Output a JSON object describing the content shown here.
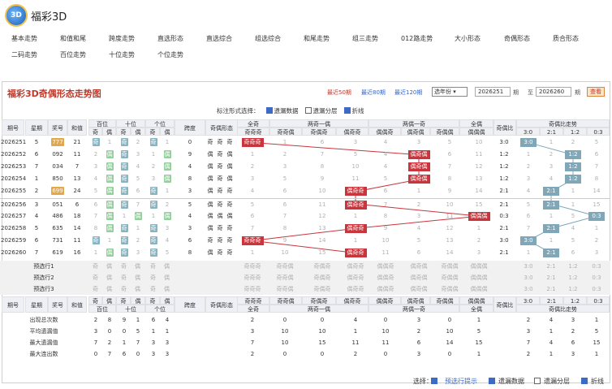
{
  "app": {
    "title": "福彩3D",
    "logo_text": "3D"
  },
  "nav": [
    [
      "基本走势",
      "和值和尾",
      "跨度走势",
      "直选形态",
      "直选综合",
      "组选综合",
      "和尾走势",
      "组三走势",
      "012路走势",
      "大小形态",
      "奇偶形态",
      "质合形态"
    ],
    [
      "二码走势",
      "百位走势",
      "十位走势",
      "个位走势"
    ]
  ],
  "panel": {
    "title": "福彩3D奇偶形态走势图",
    "ranges": [
      "最近50期",
      "最近80期",
      "最近120期"
    ],
    "year_select": "选年份",
    "from": "2026251",
    "from_unit": "期",
    "to_label": "至",
    "to": "2026260",
    "to_unit": "期",
    "query_label": "查看",
    "options_label": "标注形式选择：",
    "options": [
      "遗漏数据",
      "遗漏分层",
      "折线"
    ]
  },
  "headers": {
    "top": [
      "期号",
      "星期",
      "奖号",
      "和值",
      "百位",
      "十位",
      "个位",
      "跨度",
      "奇偶形态",
      "全奇",
      "两奇一偶",
      "两偶一奇",
      "全偶",
      "奇偶比",
      "奇偶比走势"
    ],
    "sub": [
      "奇",
      "偶",
      "奇",
      "偶",
      "奇",
      "偶",
      "奇奇奇",
      "奇奇偶",
      "奇偶奇",
      "偶奇奇",
      "偶偶奇",
      "偶奇偶",
      "奇偶偶",
      "偶偶偶",
      "3:0",
      "2:1",
      "1:2",
      "0:3"
    ]
  },
  "rows": [
    {
      "issue": "2026251",
      "week": "5",
      "num": "777",
      "sum": "21",
      "bai": [
        "奇",
        "1"
      ],
      "shi": [
        "奇",
        "2"
      ],
      "ge": [
        "奇",
        "1"
      ],
      "span": "0",
      "form": [
        "奇",
        "奇",
        "奇"
      ],
      "cols": [
        "奇奇奇",
        "1",
        "6",
        "3",
        "4",
        "3",
        "5",
        "10"
      ],
      "ratio": "3:0",
      "rt": [
        "3:0",
        "1",
        "2",
        "5"
      ]
    },
    {
      "issue": "2026252",
      "week": "6",
      "num": "092",
      "sum": "11",
      "bai": [
        "2",
        "偶"
      ],
      "shi": [
        "奇",
        "3"
      ],
      "ge": [
        "1",
        "偶"
      ],
      "span": "9",
      "form": [
        "偶",
        "奇",
        "偶"
      ],
      "cols": [
        "1",
        "2",
        "7",
        "5",
        "4",
        "偶奇偶",
        "6",
        "11"
      ],
      "ratio": "1:2",
      "rt": [
        "1",
        "2",
        "1:2",
        "6"
      ]
    },
    {
      "issue": "2026253",
      "week": "7",
      "num": "034",
      "sum": "7",
      "bai": [
        "3",
        "偶"
      ],
      "shi": [
        "奇",
        "4"
      ],
      "ge": [
        "2",
        "偶"
      ],
      "span": "4",
      "form": [
        "偶",
        "奇",
        "偶"
      ],
      "cols": [
        "2",
        "3",
        "8",
        "10",
        "4",
        "偶奇偶",
        "7",
        "12"
      ],
      "ratio": "1:2",
      "rt": [
        "2",
        "3",
        "1:2",
        "7"
      ]
    },
    {
      "issue": "2026254",
      "week": "1",
      "num": "850",
      "sum": "13",
      "bai": [
        "4",
        "偶"
      ],
      "shi": [
        "奇",
        "5"
      ],
      "ge": [
        "3",
        "偶"
      ],
      "span": "8",
      "form": [
        "偶",
        "奇",
        "偶"
      ],
      "cols": [
        "3",
        "5",
        "9",
        "11",
        "5",
        "偶奇偶",
        "8",
        "13"
      ],
      "ratio": "1:2",
      "rt": [
        "3",
        "4",
        "1:2",
        "8"
      ]
    },
    {
      "issue": "2026255",
      "week": "2",
      "num": "699",
      "sum": "24",
      "bai": [
        "5",
        "偶"
      ],
      "shi": [
        "奇",
        "6"
      ],
      "ge": [
        "奇",
        "1"
      ],
      "span": "3",
      "form": [
        "偶",
        "奇",
        "奇"
      ],
      "cols": [
        "4",
        "6",
        "10",
        "偶奇奇",
        "6",
        "1",
        "9",
        "14"
      ],
      "ratio": "2:1",
      "rt": [
        "4",
        "2:1",
        "1",
        "14"
      ]
    },
    {
      "issue": "2026256",
      "week": "3",
      "num": "051",
      "sum": "6",
      "bai": [
        "6",
        "偶"
      ],
      "shi": [
        "奇",
        "7"
      ],
      "ge": [
        "奇",
        "2"
      ],
      "span": "5",
      "form": [
        "偶",
        "奇",
        "奇"
      ],
      "cols": [
        "5",
        "6",
        "11",
        "偶奇奇",
        "7",
        "2",
        "10",
        "15"
      ],
      "ratio": "2:1",
      "rt": [
        "5",
        "2:1",
        "1",
        "15"
      ]
    },
    {
      "issue": "2026257",
      "week": "4",
      "num": "486",
      "sum": "18",
      "bai": [
        "7",
        "偶"
      ],
      "shi": [
        "1",
        "偶"
      ],
      "ge": [
        "1",
        "偶"
      ],
      "span": "4",
      "form": [
        "偶",
        "偶",
        "偶"
      ],
      "cols": [
        "6",
        "7",
        "12",
        "1",
        "8",
        "3",
        "11",
        "偶偶偶"
      ],
      "ratio": "0:3",
      "rt": [
        "6",
        "1",
        "5",
        "0:3"
      ]
    },
    {
      "issue": "2026258",
      "week": "5",
      "num": "635",
      "sum": "14",
      "bai": [
        "8",
        "偶"
      ],
      "shi": [
        "奇",
        "1"
      ],
      "ge": [
        "奇",
        "3"
      ],
      "span": "3",
      "form": [
        "偶",
        "奇",
        "奇"
      ],
      "cols": [
        "7",
        "8",
        "13",
        "偶奇奇",
        "9",
        "4",
        "12",
        "1"
      ],
      "ratio": "2:1",
      "rt": [
        "7",
        "2:1",
        "4",
        "1"
      ]
    },
    {
      "issue": "2026259",
      "week": "6",
      "num": "731",
      "sum": "11",
      "bai": [
        "奇",
        "1"
      ],
      "shi": [
        "奇",
        "2"
      ],
      "ge": [
        "奇",
        "4"
      ],
      "span": "6",
      "form": [
        "奇",
        "奇",
        "奇"
      ],
      "cols": [
        "奇奇奇",
        "9",
        "14",
        "1",
        "10",
        "5",
        "13",
        "2"
      ],
      "ratio": "3:0",
      "rt": [
        "3:0",
        "1",
        "5",
        "2"
      ]
    },
    {
      "issue": "2026260",
      "week": "7",
      "num": "619",
      "sub": "",
      "sum": "16",
      "bai": [
        "1",
        "偶"
      ],
      "shi": [
        "奇",
        "3"
      ],
      "ge": [
        "奇",
        "5"
      ],
      "span": "8",
      "form": [
        "偶",
        "奇",
        "奇"
      ],
      "cols": [
        "1",
        "10",
        "15",
        "偶奇奇",
        "11",
        "6",
        "14",
        "3"
      ],
      "ratio": "2:1",
      "rt": [
        "1",
        "2:1",
        "6",
        "3"
      ]
    }
  ],
  "forecast": [
    {
      "label": "预选行1",
      "cols": [
        "奇偶",
        "奇偶",
        "奇偶",
        "奇奇奇",
        "奇奇偶",
        "奇偶奇",
        "偶奇奇",
        "偶偶奇",
        "偶奇偶",
        "奇偶偶",
        "偶偶偶",
        "3:0",
        "2:1",
        "1:2",
        "0:3"
      ]
    },
    {
      "label": "预选行2",
      "cols": [
        "奇偶",
        "奇偶",
        "奇偶",
        "奇奇奇",
        "奇奇偶",
        "奇偶奇",
        "偶奇奇",
        "偶偶奇",
        "偶奇偶",
        "奇偶偶",
        "偶偶偶",
        "3:0",
        "2:1",
        "1:2",
        "0:3"
      ]
    },
    {
      "label": "预选行3",
      "cols": [
        "奇偶",
        "奇偶",
        "奇偶",
        "奇奇奇",
        "奇奇偶",
        "奇偶奇",
        "偶奇奇",
        "偶偶奇",
        "偶奇偶",
        "奇偶偶",
        "偶偶偶",
        "3:0",
        "2:1",
        "1:2",
        "0:3"
      ]
    }
  ],
  "stats": [
    {
      "label": "出现总次数",
      "vals": [
        "2",
        "8",
        "9",
        "1",
        "6",
        "4",
        "2",
        "0",
        "0",
        "4",
        "0",
        "3",
        "0",
        "1",
        "2",
        "4",
        "3",
        "1"
      ]
    },
    {
      "label": "平均遗漏值",
      "vals": [
        "3",
        "0",
        "0",
        "5",
        "1",
        "1",
        "3",
        "10",
        "10",
        "1",
        "10",
        "2",
        "10",
        "5",
        "3",
        "1",
        "2",
        "5"
      ]
    },
    {
      "label": "最大遗漏值",
      "vals": [
        "7",
        "2",
        "1",
        "7",
        "3",
        "3",
        "7",
        "10",
        "15",
        "11",
        "11",
        "6",
        "14",
        "15",
        "7",
        "4",
        "6",
        "15"
      ]
    },
    {
      "label": "最大连出数",
      "vals": [
        "0",
        "7",
        "6",
        "0",
        "3",
        "3",
        "2",
        "0",
        "0",
        "2",
        "0",
        "3",
        "0",
        "1",
        "2",
        "1",
        "3",
        "1"
      ]
    }
  ],
  "footer": {
    "label": "选择：",
    "options": [
      "预选行提示",
      "遗漏数据",
      "遗漏分层",
      "折线"
    ]
  }
}
